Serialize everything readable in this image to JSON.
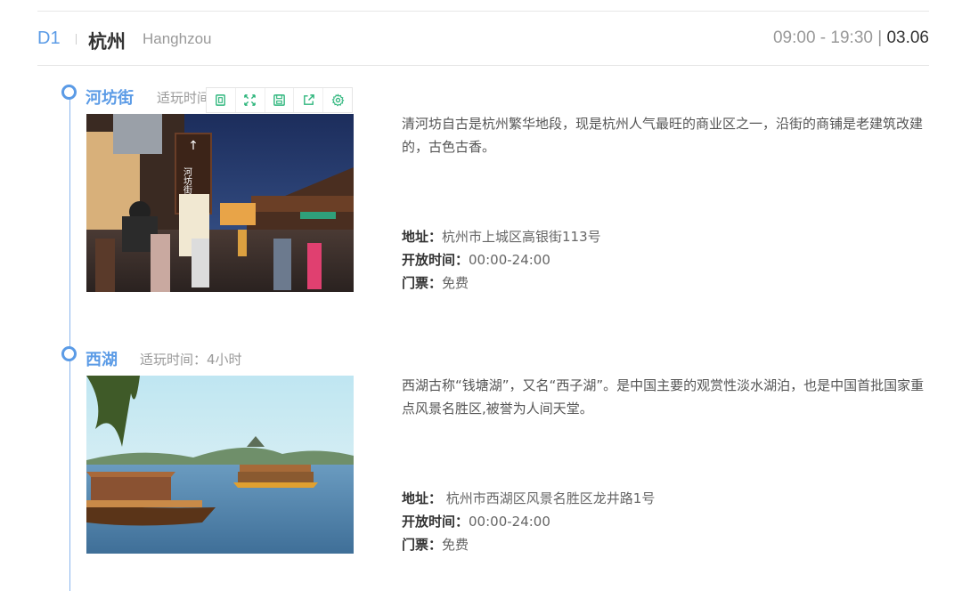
{
  "day": {
    "label": "D1",
    "city_cn": "杭州",
    "city_en": "Hanghzou",
    "time_range": "09:00 - 19:30 | ",
    "date": "03.06"
  },
  "toolbar": {
    "icons": [
      "copy-icon",
      "expand-icon",
      "save-icon",
      "share-icon",
      "settings-icon"
    ],
    "accent": "#2fb67d"
  },
  "spots": [
    {
      "name": "河坊街",
      "duration": "适玩时间：3小时",
      "description": "清河坊自古是杭州繁华地段，现是杭州人气最旺的商业区之一，沿街的商铺是老建筑改建的，古色古香。",
      "address_label": "地址：",
      "address": "杭州市上城区高银街113号",
      "hours_label": "开放时间：",
      "hours": "00:00-24:00",
      "ticket_label": "门票：",
      "ticket": "免费",
      "sign_text": "河坊街"
    },
    {
      "name": "西湖",
      "duration": "适玩时间：4小时",
      "description": "西湖古称“钱塘湖”，又名“西子湖”。是中国主要的观赏性淡水湖泊，也是中国首批国家重点风景名胜区,被誉为人间天堂。",
      "address_label": "地址：",
      "address": " 杭州市西湖区风景名胜区龙井路1号",
      "hours_label": "开放时间：",
      "hours": "00:00-24:00",
      "ticket_label": "门票：",
      "ticket": "免费"
    }
  ],
  "colors": {
    "primary": "#5b9be6",
    "muted": "#999999",
    "divider": "#e6e6e6"
  }
}
